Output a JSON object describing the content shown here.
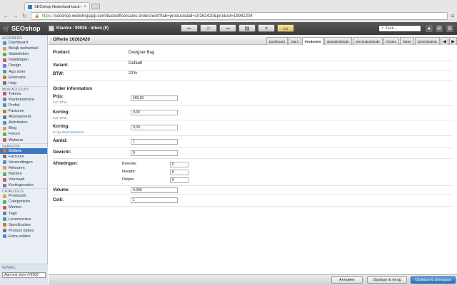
{
  "browser": {
    "tab_title": "SEOshop Nederland back o",
    "url_scheme": "https://",
    "url_rest": "seoshop.webshopapp.com/backoffice/sales-orders/edit?tab=products&id=10262420&product=19942204"
  },
  "appbar": {
    "logo": "SEOshop",
    "customer": "Klantnr.: 90936 - Inbox (0)",
    "search_placeholder": "Zoek..."
  },
  "sidebar": {
    "sections": [
      {
        "title": "ALGEMEEN",
        "items": [
          "Dashboard",
          "Bekijk webwinkel",
          "Statistieken",
          "Instellingen",
          "Design",
          "App store",
          "Extensies",
          "Help"
        ]
      },
      {
        "title": "MIJN ACCOUNT",
        "items": [
          "Tokens",
          "Klantenservice",
          "Profiel",
          "Facturen",
          "Abonnement",
          "Activiteiten",
          "Blog",
          "Forum",
          "Webinar"
        ]
      },
      {
        "title": "VERKOOP",
        "items": [
          "Orders",
          "Facturen",
          "Verzendingen",
          "Retouren",
          "Klanten",
          "Voorraad",
          "Kortingscodes"
        ]
      },
      {
        "title": "CATALOGUS",
        "items": [
          "Producten",
          "Categorieën",
          "Merken",
          "Tags",
          "Leveranciers",
          "Specificaties",
          "Product opties",
          "Extra velden"
        ]
      }
    ],
    "active": "Orders",
    "winkel_label": "WINKEL",
    "winkel_value": "App test store (#9509"
  },
  "content": {
    "title": "Offerte 10262420",
    "tabs": [
      "Dashboard",
      "Klant",
      "Producten",
      "Betaalmethode",
      "Verzendmethode",
      "Tickets",
      "Taken",
      "Geschiedenis"
    ],
    "active_tab": "Producten",
    "product_label": "Product:",
    "product_value": "Designer Bag",
    "variant_label": "Variant:",
    "variant_value": "Default",
    "btw_label": "BTW:",
    "btw_value": "21%",
    "order_info": "Order information",
    "prijs_label": "Prijs:",
    "prijs_sub": "Incl. BTW",
    "prijs_value": "400,00",
    "korting1_label": "Korting:",
    "korting1_sub": "Incl. BTW",
    "korting1_value": "0,00",
    "korting2_label": "Korting:",
    "korting2_sub_prefix": "% (by ",
    "korting2_sub_link": "OmCommerce",
    "korting2_sub_suffix": ")",
    "korting2_value": "0,00",
    "aantal_label": "Aantal:",
    "aantal_value": "1",
    "gewicht_label": "Gewicht:",
    "gewicht_value": "0",
    "afmetingen_label": "Afmetingen:",
    "breedte_label": "Breedte:",
    "breedte_value": "0",
    "hoogte_label": "Hoogte:",
    "hoogte_value": "0",
    "diepte_label": "Diepte:",
    "diepte_value": "0",
    "volume_label": "Volume:",
    "volume_value": "0.000",
    "colli_label": "Colli:",
    "colli_value": "1"
  },
  "footer": {
    "cancel": "Annuleer",
    "save_back": "Opslaan & terug",
    "save_stay": "Opslaan & doorgaan"
  },
  "colors": {
    "accent": "#3e78c3",
    "appbar": "#3a3a3a"
  }
}
